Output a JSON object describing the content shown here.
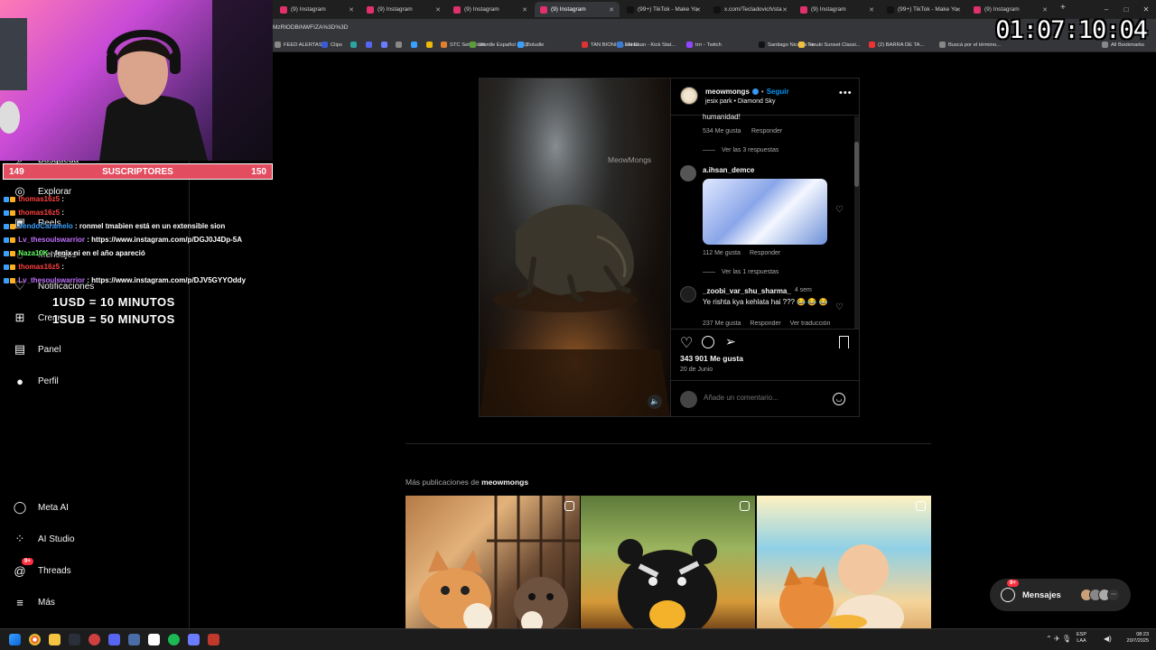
{
  "browser": {
    "tabs": [
      {
        "label": "(9) Instagram",
        "fav": "#e1306c"
      },
      {
        "label": "(9) Instagram",
        "fav": "#e1306c"
      },
      {
        "label": "(9) Instagram",
        "fav": "#e1306c"
      },
      {
        "label": "(9) Instagram",
        "fav": "#e1306c",
        "active": true
      },
      {
        "label": "(99+) TikTok - Make Yo",
        "fav": "#111"
      },
      {
        "label": "x.com/Tecladovich/sta",
        "fav": "#111"
      },
      {
        "label": "(9) Instagram",
        "fav": "#e1306c"
      },
      {
        "label": "(99+) TikTok - Make Yo",
        "fav": "#111"
      },
      {
        "label": "(9) Instagram",
        "fav": "#e1306c"
      }
    ],
    "new_tab": "+",
    "address_fragment": "MzRlODBiNWFIZA%3D%3D",
    "bookmarks": [
      "FEED ALERTAS",
      "Clips",
      "",
      "",
      "",
      "",
      "",
      "",
      "STC Set Prices",
      "Wordle Español (ES)",
      "Boludle",
      "TAN BIONICA EN EL...",
      "sionaron - Kick Stat...",
      "trrr - Twitch",
      "Santiago Nicolas Fe...",
      "Tanuki Sunset Classi...",
      "(2) BARRA DE TA...",
      "Buscá por el término...",
      "All Bookmarks"
    ],
    "window_controls": [
      "–",
      "□",
      "✕"
    ]
  },
  "overlay": {
    "subs_left": "149",
    "subs_label": "SUSCRIPTORES",
    "subs_right": "150",
    "timer": "01:07:10:04",
    "chat": [
      {
        "user": "thomas16z5",
        "color": "#ff4040",
        "msg": ":"
      },
      {
        "user": "thomas16z5",
        "color": "#ff4040",
        "msg": ":"
      },
      {
        "user": "VendoCaramelo",
        "color": "#3aa0ff",
        "msg": ": ronmel tmabien está en un extensible sion"
      },
      {
        "user": "Lv_thesoulswarrior",
        "color": "#c070ff",
        "msg": ": https://www.instagram.com/p/DGJ0J4Dp-5A"
      },
      {
        "user": "Naza10K",
        "color": "#60ff60",
        "msg": ": fenix ni en el año apareció"
      },
      {
        "user": "thomas16z5",
        "color": "#ff4040",
        "msg": ":"
      },
      {
        "user": "Lv_thesoulswarrior",
        "color": "#c070ff",
        "msg": ": https://www.instagram.com/p/DJV5GYYOddy"
      }
    ],
    "rate1": "1USD = 10 MINUTOS",
    "rate2": "1SUB = 50 MINUTOS"
  },
  "sidebar": {
    "items": [
      {
        "label": "Búsqueda",
        "icon": "search-icon",
        "glyph": "⌕"
      },
      {
        "label": "Explorar",
        "icon": "compass-icon",
        "glyph": "◎"
      },
      {
        "label": "Reels",
        "icon": "reels-icon",
        "glyph": "▣"
      },
      {
        "label": "Mensajes",
        "icon": "messenger-icon",
        "glyph": "◌"
      },
      {
        "label": "Notificaciones",
        "icon": "heart-icon",
        "glyph": "♡"
      },
      {
        "label": "Crear",
        "icon": "plus-square-icon",
        "glyph": "⊞"
      },
      {
        "label": "Panel",
        "icon": "chart-icon",
        "glyph": "▤"
      },
      {
        "label": "Perfil",
        "icon": "avatar-icon",
        "glyph": "●"
      }
    ],
    "bottom": [
      {
        "label": "Meta AI",
        "icon": "meta-ai-icon",
        "glyph": "◯"
      },
      {
        "label": "AI Studio",
        "icon": "ai-studio-icon",
        "glyph": "⁘"
      },
      {
        "label": "Threads",
        "icon": "threads-icon",
        "glyph": "@",
        "badge": "9+"
      },
      {
        "label": "Más",
        "icon": "menu-icon",
        "glyph": "≡"
      }
    ]
  },
  "post": {
    "author": "meowmongs",
    "follow": "Seguir",
    "dot": "•",
    "audio": "jesix park • Diamond Sky",
    "watermark": "MeowMongs",
    "comments": {
      "c0_tail": "humanidad!",
      "c0_likes": "534 Me gusta",
      "c0_reply": "Responder",
      "c0_view": "Ver las 3 respuestas",
      "c1_user": "a.ihsan_demce",
      "c1_likes": "112 Me gusta",
      "c1_reply": "Responder",
      "c1_view": "Ver las 1 respuestas",
      "c2_user": "_zoobi_var_shu_sharma_",
      "c2_time": "4 sem",
      "c2_text": "Ye rishta kya kehlata hai ??? 😂 😂 😂",
      "c2_likes": "237 Me gusta",
      "c2_reply": "Responder",
      "c2_translate": "Ver traducción"
    },
    "likes": "343 901 Me gusta",
    "date": "20 de Junio",
    "comment_placeholder": "Añade un comentario..."
  },
  "more": {
    "prefix": "Más publicaciones de",
    "author": "meowmongs"
  },
  "messages": {
    "label": "Mensajes",
    "badge": "9+"
  },
  "taskbar": {
    "lang1": "ESP",
    "lang2": "LAA",
    "time": "08:23",
    "date": "20/7/2025"
  }
}
